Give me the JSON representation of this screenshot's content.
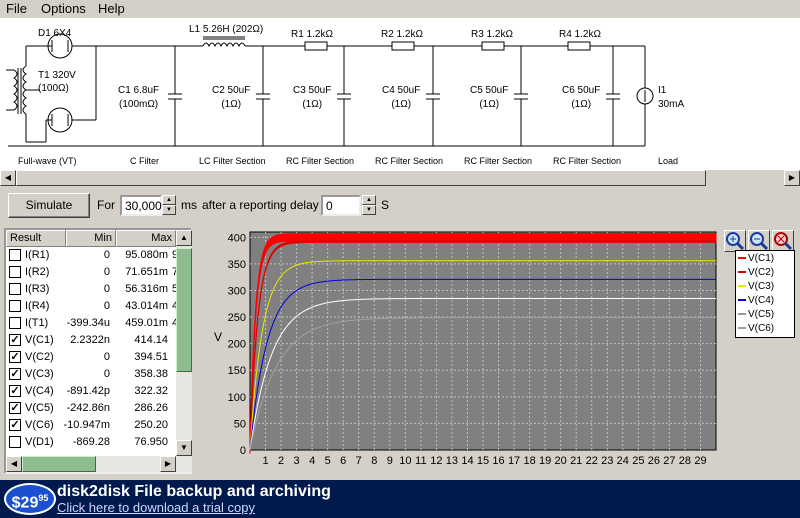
{
  "menu": [
    "File",
    "Options",
    "Help"
  ],
  "schematic": {
    "components": {
      "d1": "D1 6X4",
      "t1": "T1 320V",
      "t1_r": "(100Ω)",
      "l1": "L1 5.26H (202Ω)",
      "r1": "R1 1.2kΩ",
      "r2": "R2 1.2kΩ",
      "r3": "R3 1.2kΩ",
      "r4": "R4 1.2kΩ",
      "c1": "C1 6.8uF",
      "c1_r": "(100mΩ)",
      "c2": "C2 50uF",
      "c3": "C3 50uF",
      "c4": "C4 50uF",
      "c5": "C5 50uF",
      "c6": "C6 50uF",
      "cap_r": "(1Ω)",
      "i1": "I1",
      "i1_val": "30mA"
    },
    "sections": [
      "Full-wave (VT)",
      "C Filter",
      "LC Filter Section",
      "RC Filter Section",
      "RC Filter Section",
      "RC Filter Section",
      "RC Filter Section",
      "Load"
    ]
  },
  "controls": {
    "simulate_label": "Simulate",
    "for_label": "For",
    "duration_value": "30,000",
    "ms_label": "ms",
    "delay_label": "after a reporting delay of",
    "delay_value": "0",
    "s_label": "S"
  },
  "results": {
    "headers": [
      "Result",
      "Min",
      "Max"
    ],
    "rows": [
      {
        "checked": false,
        "name": "I(R1)",
        "min": "0",
        "max": "95.080m",
        "extra": "9"
      },
      {
        "checked": false,
        "name": "I(R2)",
        "min": "0",
        "max": "71.651m",
        "extra": "7"
      },
      {
        "checked": false,
        "name": "I(R3)",
        "min": "0",
        "max": "56.316m",
        "extra": "5"
      },
      {
        "checked": false,
        "name": "I(R4)",
        "min": "0",
        "max": "43.014m",
        "extra": "4"
      },
      {
        "checked": false,
        "name": "I(T1)",
        "min": "-399.34u",
        "max": "459.01m",
        "extra": "4"
      },
      {
        "checked": true,
        "name": "V(C1)",
        "min": "2.2322n",
        "max": "414.14",
        "extra": ""
      },
      {
        "checked": true,
        "name": "V(C2)",
        "min": "0",
        "max": "394.51",
        "extra": ""
      },
      {
        "checked": true,
        "name": "V(C3)",
        "min": "0",
        "max": "358.38",
        "extra": ""
      },
      {
        "checked": true,
        "name": "V(C4)",
        "min": "-891.42p",
        "max": "322.32",
        "extra": ""
      },
      {
        "checked": true,
        "name": "V(C5)",
        "min": "-242.86n",
        "max": "286.26",
        "extra": ""
      },
      {
        "checked": true,
        "name": "V(C6)",
        "min": "-10.947m",
        "max": "250.20",
        "extra": ""
      },
      {
        "checked": false,
        "name": "V(D1)",
        "min": "-869.28",
        "max": "76.950",
        "extra": ""
      }
    ]
  },
  "chart_data": {
    "type": "line",
    "ylabel": "V",
    "xlim": [
      0,
      30
    ],
    "ylim": [
      0,
      410
    ],
    "x_ticks": [
      1,
      2,
      3,
      4,
      5,
      6,
      7,
      8,
      9,
      10,
      11,
      12,
      13,
      14,
      15,
      16,
      17,
      18,
      19,
      20,
      21,
      22,
      23,
      24,
      25,
      26,
      27,
      28,
      29
    ],
    "y_ticks": [
      0,
      50,
      100,
      150,
      200,
      250,
      300,
      350,
      400
    ],
    "grid": true,
    "legend_position": "top-right",
    "series": [
      {
        "name": "V(C1)",
        "color": "#ff0000",
        "final": 400,
        "ripple": 14,
        "tau": 0.35
      },
      {
        "name": "V(C2)",
        "color": "#e00000",
        "final": 392,
        "ripple": 3,
        "tau": 0.5
      },
      {
        "name": "V(C3)",
        "color": "#e8e800",
        "final": 356,
        "ripple": 0,
        "tau": 0.8
      },
      {
        "name": "V(C4)",
        "color": "#0000dd",
        "final": 321,
        "ripple": 0,
        "tau": 1.1
      },
      {
        "name": "V(C5)",
        "color": "#ffffff",
        "final": 285,
        "ripple": 0,
        "tau": 1.4
      },
      {
        "name": "V(C6)",
        "color": "#a0a0a0",
        "final": 249,
        "ripple": 0,
        "tau": 1.7
      }
    ]
  },
  "banner": {
    "price": "$29",
    "price_cents": "95",
    "title": "disk2disk File backup and archiving",
    "link": "Click here to download a trial copy"
  }
}
